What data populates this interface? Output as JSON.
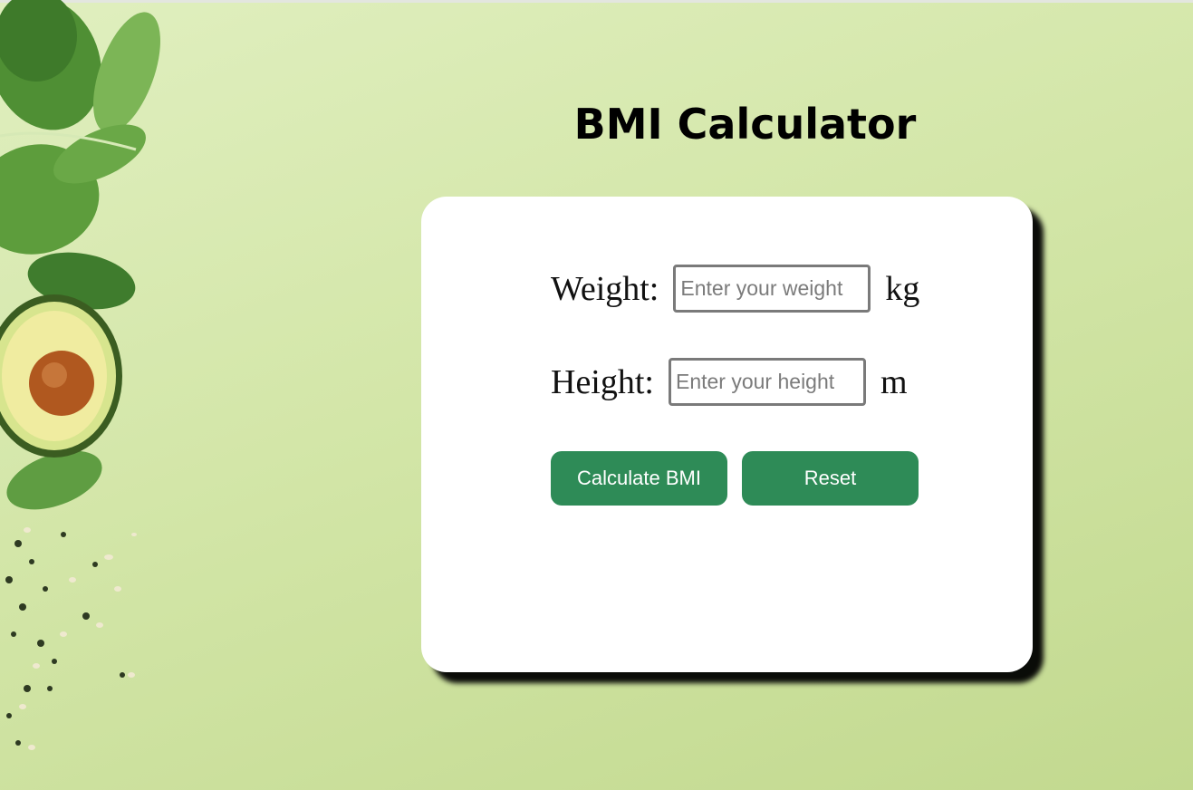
{
  "page": {
    "title": "BMI Calculator"
  },
  "form": {
    "weight": {
      "label": "Weight:",
      "placeholder": "Enter your weight",
      "value": "",
      "unit": "kg"
    },
    "height": {
      "label": "Height:",
      "placeholder": "Enter your height",
      "value": "",
      "unit": "m"
    },
    "buttons": {
      "calculate_label": "Calculate BMI",
      "reset_label": "Reset"
    }
  },
  "colors": {
    "background": "#d3e6a8",
    "card": "#ffffff",
    "button": "#2e8b57",
    "button_text": "#ffffff"
  },
  "decor": {
    "icons": [
      "spinach-leaves-image",
      "avocado-image",
      "seeds-image"
    ]
  }
}
